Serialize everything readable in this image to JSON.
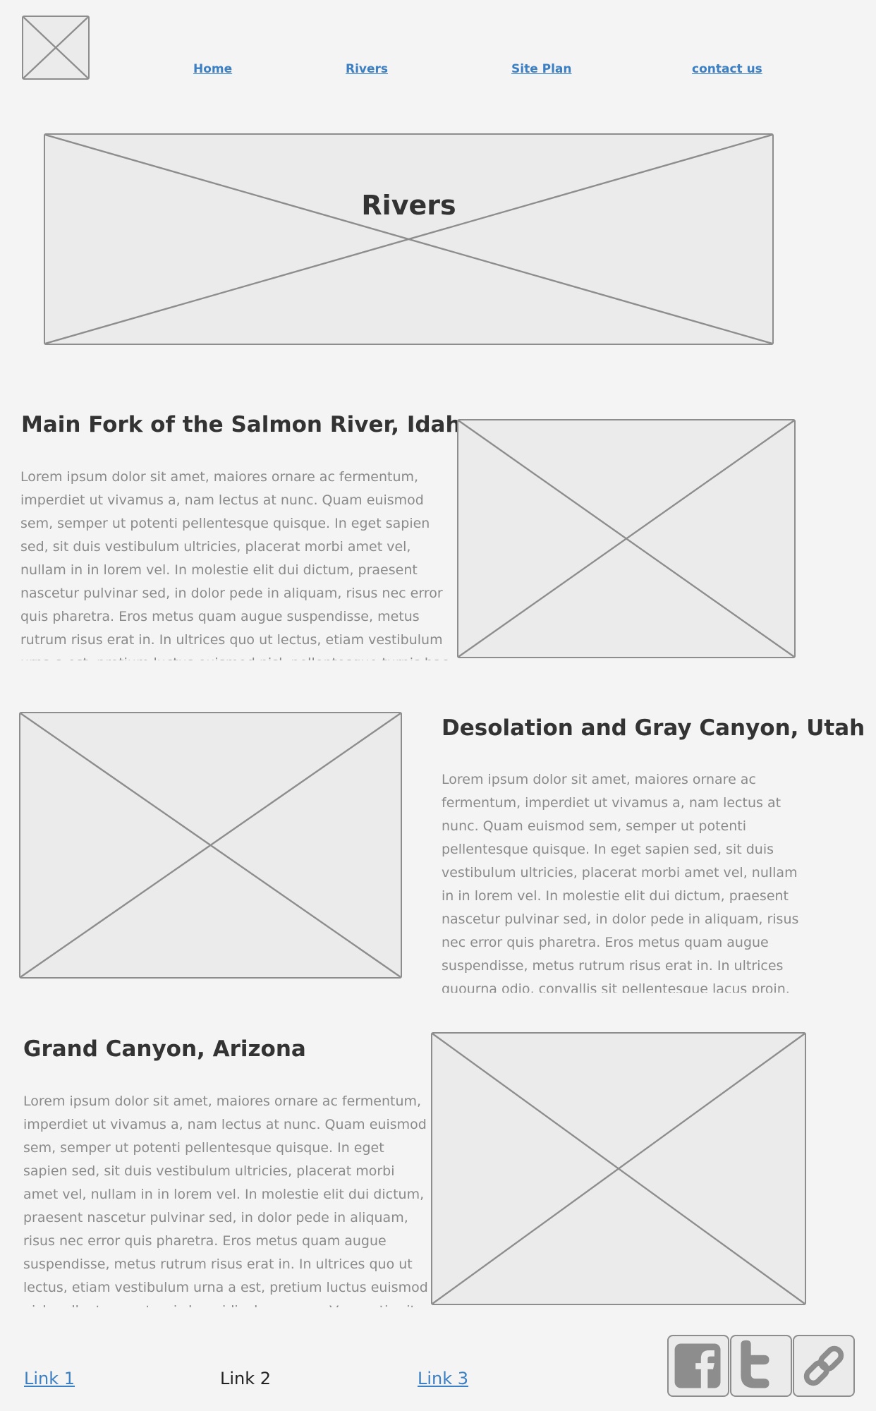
{
  "header": {
    "logo_icon": "image-placeholder-icon",
    "nav": [
      {
        "label": "Home"
      },
      {
        "label": "Rivers"
      },
      {
        "label": "Site Plan"
      },
      {
        "label": "contact us"
      }
    ]
  },
  "banner": {
    "title": "Rivers",
    "icon": "image-placeholder-icon"
  },
  "sections": [
    {
      "title": "Main Fork of the Salmon River, Idaho",
      "body": "Lorem ipsum dolor sit amet, maiores ornare ac fermentum, imperdiet ut vivamus a, nam lectus at nunc. Quam euismod sem, semper ut potenti pellentesque quisque. In eget sapien sed, sit duis vestibulum ultricies, placerat morbi amet vel, nullam in in lorem vel. In molestie elit dui dictum, praesent nascetur pulvinar sed, in dolor pede in aliquam, risus nec error quis pharetra. Eros metus quam augue suspendisse, metus rutrum risus erat in.  In ultrices quo ut lectus, etiam vestibulum urna a est, pretium luctus euismod nisl, pellentesque turpis hac ridiculus massa. Venenatis sit ultricies."
    },
    {
      "title": "Desolation and Gray Canyon, Utah",
      "body": "Lorem ipsum dolor sit amet, maiores ornare ac fermentum, imperdiet ut vivamus a, nam lectus at nunc. Quam euismod sem, semper ut potenti pellentesque quisque. In eget sapien sed, sit duis vestibulum ultricies, placerat morbi amet vel, nullam in in lorem vel. In molestie elit dui dictum, praesent nascetur pulvinar sed, in dolor pede in aliquam, risus nec error quis pharetra. Eros metus quam augue suspendisse, metus rutrum risus erat in.  In ultrices quourna odio, convallis sit pellentesque lacus proin."
    },
    {
      "title": "Grand Canyon, Arizona",
      "body": "Lorem ipsum dolor sit amet, maiores ornare ac fermentum, imperdiet ut vivamus a, nam lectus at nunc. Quam euismod sem, semper ut potenti pellentesque quisque. In eget sapien sed, sit duis vestibulum ultricies, placerat morbi amet vel, nullam in in lorem vel. In molestie elit dui dictum, praesent nascetur pulvinar sed, in dolor pede in aliquam, risus nec error quis pharetra. Eros metus quam augue suspendisse, metus rutrum risus erat in.  In ultrices quo ut lectus, etiam vestibulum urna a est, pretium luctus euismod nisl, pellentesque turpis hac ridiculus massa. Venenatis sit ultricies."
    }
  ],
  "footer": {
    "links": [
      {
        "label": "Link 1"
      },
      {
        "label": "Link 2"
      },
      {
        "label": "Link 3"
      }
    ],
    "social": [
      {
        "icon": "facebook-icon"
      },
      {
        "icon": "twitter-icon"
      },
      {
        "icon": "link-icon"
      }
    ]
  },
  "colors": {
    "background": "#f4f4f4",
    "placeholder_fill": "#ebebeb",
    "placeholder_stroke": "#8d8d8d",
    "link": "#3b7fc4",
    "heading": "#333333",
    "body_text": "#8a8a8a"
  }
}
